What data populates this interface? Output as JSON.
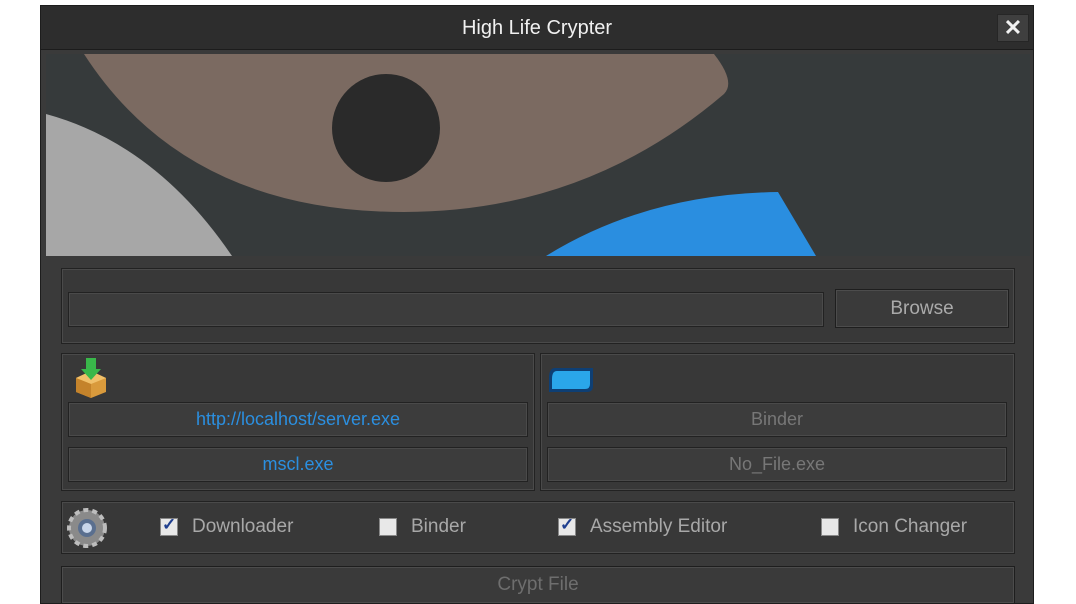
{
  "window": {
    "title": "High Life Crypter"
  },
  "file_input": {
    "value": "",
    "browse_label": "Browse"
  },
  "downloader": {
    "icon": "download-package-icon",
    "url": "http://localhost/server.exe",
    "filename": "mscl.exe"
  },
  "binder": {
    "icon": "blue-tag-icon",
    "title": "Binder",
    "filename": "No_File.exe"
  },
  "options": {
    "icon": "gear-icon",
    "items": [
      {
        "label": "Downloader",
        "checked": true
      },
      {
        "label": "Binder",
        "checked": false
      },
      {
        "label": "Assembly Editor",
        "checked": true
      },
      {
        "label": "Icon Changer",
        "checked": false
      }
    ]
  },
  "crypt": {
    "label": "Crypt File"
  },
  "colors": {
    "accent_blue": "#2b8fe0",
    "banner_blue": "#2a8ee0",
    "banner_brown": "#7b6a61"
  }
}
